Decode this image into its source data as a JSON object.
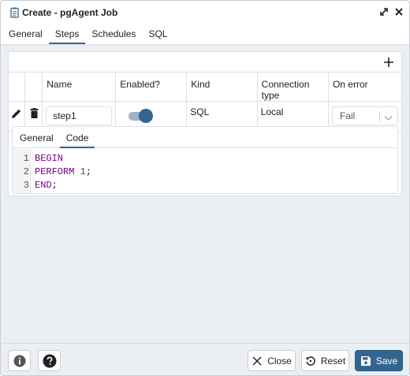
{
  "dialog": {
    "title": "Create - pgAgent Job"
  },
  "tabs": [
    {
      "label": "General",
      "active": false
    },
    {
      "label": "Steps",
      "active": true
    },
    {
      "label": "Schedules",
      "active": false
    },
    {
      "label": "SQL",
      "active": false
    }
  ],
  "steps_table": {
    "columns": [
      "Name",
      "Enabled?",
      "Kind",
      "Connection type",
      "On error"
    ],
    "rows": [
      {
        "name": "step1",
        "enabled": true,
        "kind": "SQL",
        "connection_type": "Local",
        "on_error": "Fail"
      }
    ]
  },
  "step_detail": {
    "tabs": [
      {
        "label": "General",
        "active": false
      },
      {
        "label": "Code",
        "active": true
      }
    ],
    "code_lines": [
      {
        "n": "1",
        "text": "BEGIN"
      },
      {
        "n": "2",
        "text": "PERFORM 1;"
      },
      {
        "n": "3",
        "text": "END;"
      }
    ]
  },
  "footer": {
    "close_label": "Close",
    "reset_label": "Reset",
    "save_label": "Save"
  },
  "colors": {
    "accent": "#326690",
    "background": "#ebeef3"
  },
  "icons": [
    "document-icon",
    "expand-icon",
    "close-icon",
    "plus-icon",
    "edit-icon",
    "trash-icon",
    "chevron-down-icon",
    "info-icon",
    "help-icon",
    "reset-icon",
    "save-icon"
  ]
}
